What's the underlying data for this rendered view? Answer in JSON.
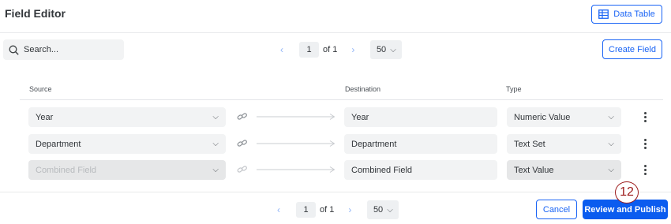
{
  "header": {
    "title": "Field Editor",
    "data_table_label": "Data Table"
  },
  "toolbar": {
    "search_placeholder": "Search...",
    "create_field_label": "Create Field"
  },
  "pagination": {
    "prev": "‹",
    "next": "›",
    "page": "1",
    "of_label": "of 1",
    "per_page": "50"
  },
  "columns": {
    "source": "Source",
    "destination": "Destination",
    "type": "Type"
  },
  "rows": [
    {
      "source": "Year",
      "destination": "Year",
      "type": "Numeric Value"
    },
    {
      "source": "Department",
      "destination": "Department",
      "type": "Text Set"
    },
    {
      "source": "Combined Field",
      "destination": "Combined Field",
      "type": "Text Value"
    }
  ],
  "footer": {
    "cancel_label": "Cancel",
    "publish_label": "Review and Publish"
  },
  "annotation": {
    "step": "12"
  },
  "colors": {
    "accent": "#1a64f5",
    "primary_button": "#0b5cef",
    "badge": "#9c1a1a"
  }
}
